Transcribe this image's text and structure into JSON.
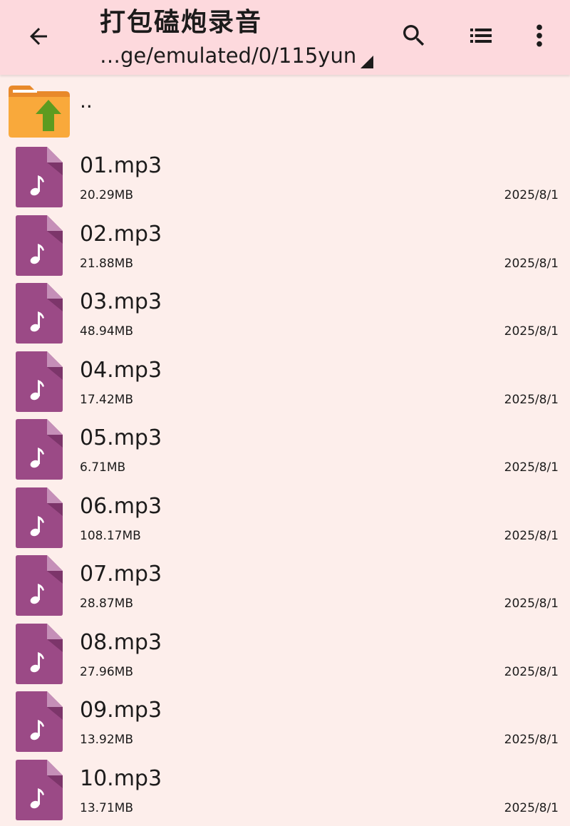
{
  "toolbar": {
    "title": "打包磕炮录音",
    "path": "…ge/emulated/0/115yun",
    "icons": {
      "back": "arrow-back-icon",
      "search": "search-icon",
      "view": "list-view-icon",
      "more": "more-vert-icon"
    }
  },
  "parent": {
    "label": ".."
  },
  "colors": {
    "toolbar_bg": "#fdd9dd",
    "page_bg": "#fdeeeb",
    "audio_icon": "#9b4a86",
    "folder": "#f9a93b",
    "folder_arrow": "#5d9b20"
  },
  "files": [
    {
      "name": "01.mp3",
      "size": "20.29MB",
      "date": "2025/8/1"
    },
    {
      "name": "02.mp3",
      "size": "21.88MB",
      "date": "2025/8/1"
    },
    {
      "name": "03.mp3",
      "size": "48.94MB",
      "date": "2025/8/1"
    },
    {
      "name": "04.mp3",
      "size": "17.42MB",
      "date": "2025/8/1"
    },
    {
      "name": "05.mp3",
      "size": "6.71MB",
      "date": "2025/8/1"
    },
    {
      "name": "06.mp3",
      "size": "108.17MB",
      "date": "2025/8/1"
    },
    {
      "name": "07.mp3",
      "size": "28.87MB",
      "date": "2025/8/1"
    },
    {
      "name": "08.mp3",
      "size": "27.96MB",
      "date": "2025/8/1"
    },
    {
      "name": "09.mp3",
      "size": "13.92MB",
      "date": "2025/8/1"
    },
    {
      "name": "10.mp3",
      "size": "13.71MB",
      "date": "2025/8/1"
    }
  ]
}
